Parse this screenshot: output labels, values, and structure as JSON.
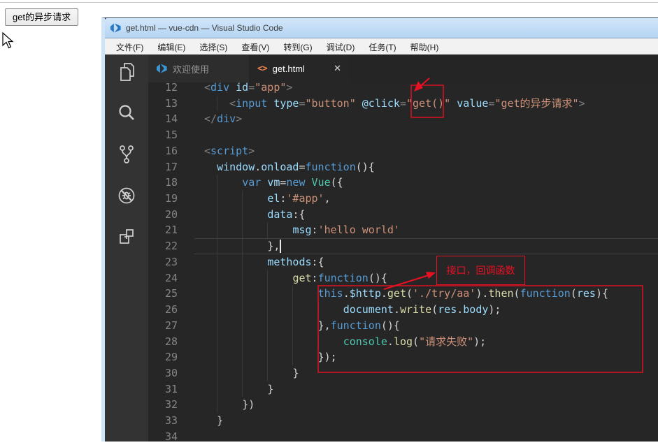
{
  "page": {
    "button_label": "get的异步请求"
  },
  "window": {
    "title": "get.html — vue-cdn — Visual Studio Code",
    "menu_items": [
      "文件(F)",
      "编辑(E)",
      "选择(S)",
      "查看(V)",
      "转到(G)",
      "调试(D)",
      "任务(T)",
      "帮助(H)"
    ],
    "tabs": [
      {
        "label": "欢迎使用",
        "active": false
      },
      {
        "label": "get.html",
        "active": true
      }
    ]
  },
  "icons": {
    "html_file_icon": "<>",
    "close_icon": "✕"
  },
  "colors": {
    "tag": "#569cd6",
    "attr": "#9cdcfe",
    "str": "#ce9178",
    "fn": "#dcdcaa",
    "cls": "#4ec9b0",
    "pun": "#d4d4d4",
    "gray": "#808080",
    "line_number": "#858585",
    "annotation": "#e81123"
  },
  "editor": {
    "current_line": 22,
    "lines": [
      {
        "num": 12,
        "indent": 0,
        "tokens": [
          [
            "gray",
            "<"
          ],
          [
            "tag",
            "div"
          ],
          [
            "pun",
            " "
          ],
          [
            "attr",
            "id"
          ],
          [
            "gray",
            "="
          ],
          [
            "str",
            "\"app\""
          ],
          [
            "gray",
            ">"
          ]
        ]
      },
      {
        "num": 13,
        "indent": 4,
        "tokens": [
          [
            "gray",
            "<"
          ],
          [
            "tag",
            "input"
          ],
          [
            "pun",
            " "
          ],
          [
            "attr",
            "type"
          ],
          [
            "gray",
            "="
          ],
          [
            "str",
            "\"button\""
          ],
          [
            "pun",
            " "
          ],
          [
            "attr",
            "@click"
          ],
          [
            "gray",
            "="
          ],
          [
            "str",
            "\"get()\""
          ],
          [
            "pun",
            " "
          ],
          [
            "attr",
            "value"
          ],
          [
            "gray",
            "="
          ],
          [
            "str",
            "\"get的异步请求\""
          ],
          [
            "gray",
            ">"
          ]
        ]
      },
      {
        "num": 14,
        "indent": 0,
        "tokens": [
          [
            "gray",
            "</"
          ],
          [
            "tag",
            "div"
          ],
          [
            "gray",
            ">"
          ]
        ]
      },
      {
        "num": 15,
        "indent": 0,
        "tokens": []
      },
      {
        "num": 16,
        "indent": 0,
        "tokens": [
          [
            "gray",
            "<"
          ],
          [
            "tag",
            "script"
          ],
          [
            "gray",
            ">"
          ]
        ]
      },
      {
        "num": 17,
        "indent": 2,
        "tokens": [
          [
            "attr",
            "window"
          ],
          [
            "pun",
            "."
          ],
          [
            "attr",
            "onload"
          ],
          [
            "pun",
            "="
          ],
          [
            "tag",
            "function"
          ],
          [
            "pun",
            "(){"
          ]
        ]
      },
      {
        "num": 18,
        "indent": 6,
        "tokens": [
          [
            "tag",
            "var"
          ],
          [
            "pun",
            " "
          ],
          [
            "attr",
            "vm"
          ],
          [
            "pun",
            "="
          ],
          [
            "tag",
            "new"
          ],
          [
            "pun",
            " "
          ],
          [
            "cls",
            "Vue"
          ],
          [
            "pun",
            "({"
          ]
        ]
      },
      {
        "num": 19,
        "indent": 10,
        "tokens": [
          [
            "attr",
            "el"
          ],
          [
            "pun",
            ":"
          ],
          [
            "str",
            "'#app'"
          ],
          [
            "pun",
            ","
          ]
        ]
      },
      {
        "num": 20,
        "indent": 10,
        "tokens": [
          [
            "attr",
            "data"
          ],
          [
            "pun",
            ":{"
          ]
        ]
      },
      {
        "num": 21,
        "indent": 14,
        "tokens": [
          [
            "attr",
            "msg"
          ],
          [
            "pun",
            ":"
          ],
          [
            "str",
            "'hello world'"
          ]
        ]
      },
      {
        "num": 22,
        "indent": 10,
        "tokens": [
          [
            "pun",
            "},"
          ]
        ]
      },
      {
        "num": 23,
        "indent": 10,
        "tokens": [
          [
            "attr",
            "methods"
          ],
          [
            "pun",
            ":{"
          ]
        ]
      },
      {
        "num": 24,
        "indent": 14,
        "tokens": [
          [
            "fn",
            "get"
          ],
          [
            "pun",
            ":"
          ],
          [
            "tag",
            "function"
          ],
          [
            "pun",
            "(){"
          ]
        ]
      },
      {
        "num": 25,
        "indent": 18,
        "tokens": [
          [
            "tag",
            "this"
          ],
          [
            "pun",
            "."
          ],
          [
            "attr",
            "$http"
          ],
          [
            "pun",
            "."
          ],
          [
            "fn",
            "get"
          ],
          [
            "pun",
            "("
          ],
          [
            "str",
            "'./try/aa'"
          ],
          [
            "pun",
            ")."
          ],
          [
            "fn",
            "then"
          ],
          [
            "pun",
            "("
          ],
          [
            "tag",
            "function"
          ],
          [
            "pun",
            "("
          ],
          [
            "attr",
            "res"
          ],
          [
            "pun",
            "){"
          ]
        ]
      },
      {
        "num": 26,
        "indent": 22,
        "tokens": [
          [
            "attr",
            "document"
          ],
          [
            "pun",
            "."
          ],
          [
            "fn",
            "write"
          ],
          [
            "pun",
            "("
          ],
          [
            "attr",
            "res"
          ],
          [
            "pun",
            "."
          ],
          [
            "attr",
            "body"
          ],
          [
            "pun",
            ");"
          ]
        ]
      },
      {
        "num": 27,
        "indent": 18,
        "tokens": [
          [
            "pun",
            "},"
          ],
          [
            "tag",
            "function"
          ],
          [
            "pun",
            "(){"
          ]
        ]
      },
      {
        "num": 28,
        "indent": 22,
        "tokens": [
          [
            "cls",
            "console"
          ],
          [
            "pun",
            "."
          ],
          [
            "fn",
            "log"
          ],
          [
            "pun",
            "("
          ],
          [
            "str",
            "\"请求失败\""
          ],
          [
            "pun",
            ");"
          ]
        ]
      },
      {
        "num": 29,
        "indent": 18,
        "tokens": [
          [
            "pun",
            "});"
          ]
        ]
      },
      {
        "num": 30,
        "indent": 14,
        "tokens": [
          [
            "pun",
            "}"
          ]
        ]
      },
      {
        "num": 31,
        "indent": 10,
        "tokens": [
          [
            "pun",
            "}"
          ]
        ]
      },
      {
        "num": 32,
        "indent": 6,
        "tokens": [
          [
            "pun",
            "})"
          ]
        ]
      },
      {
        "num": 33,
        "indent": 2,
        "tokens": [
          [
            "pun",
            "}"
          ]
        ]
      },
      {
        "num": 34,
        "indent": 0,
        "tokens": []
      }
    ]
  },
  "annotations": {
    "callout_label": "接口，回调函数"
  }
}
